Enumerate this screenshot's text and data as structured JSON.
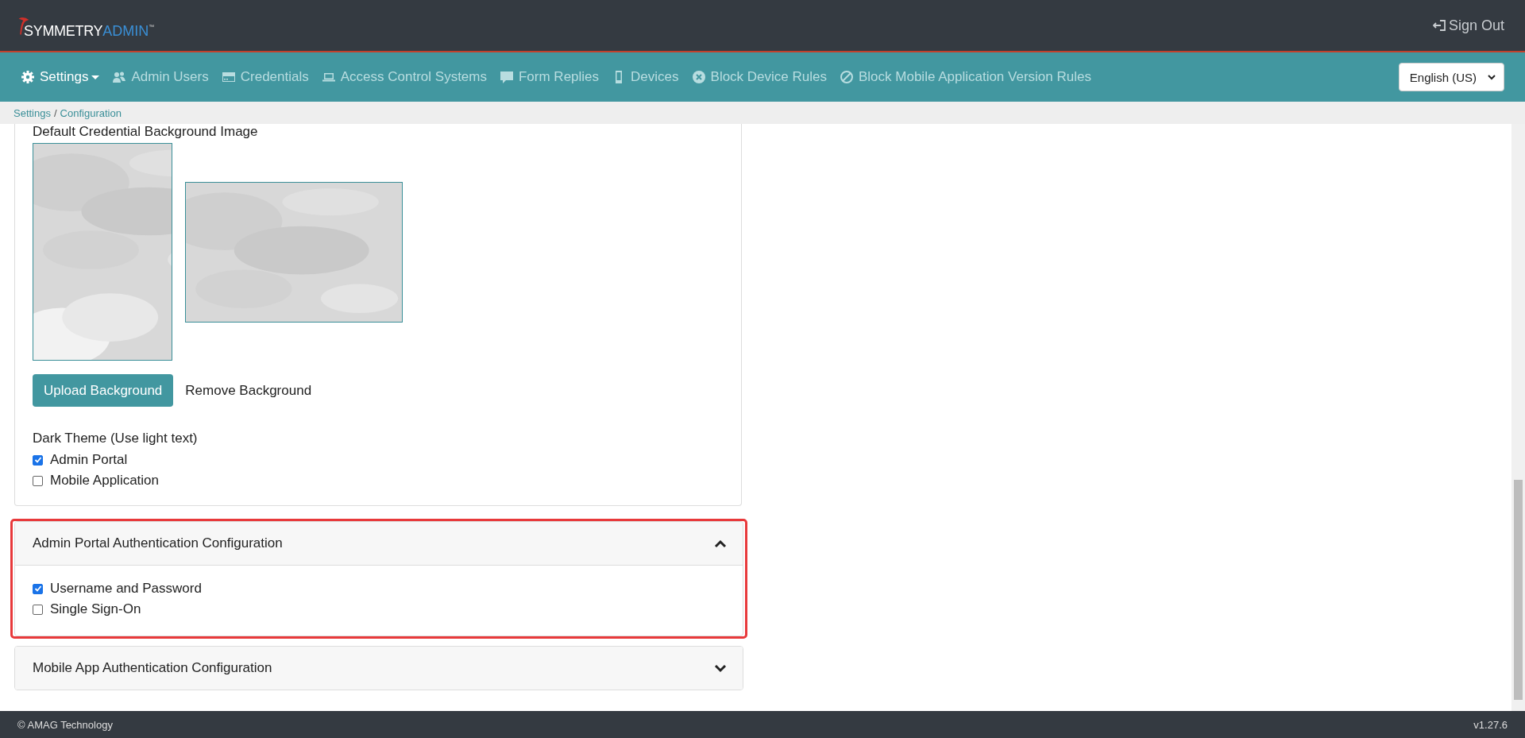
{
  "logo": {
    "text": "SYMMETRY",
    "accent": "ADMIN",
    "mark": "™"
  },
  "sign_out": "Sign Out",
  "nav": [
    {
      "label": "Settings",
      "selected": true,
      "dropdown": true
    },
    {
      "label": "Admin Users",
      "selected": false,
      "dropdown": false
    },
    {
      "label": "Credentials",
      "selected": false,
      "dropdown": false
    },
    {
      "label": "Access Control Systems",
      "selected": false,
      "dropdown": false
    },
    {
      "label": "Form Replies",
      "selected": false,
      "dropdown": false
    },
    {
      "label": "Devices",
      "selected": false,
      "dropdown": false
    },
    {
      "label": "Block Device Rules",
      "selected": false,
      "dropdown": false
    },
    {
      "label": "Block Mobile Application Version Rules",
      "selected": false,
      "dropdown": false
    }
  ],
  "language": {
    "value": "English (US)"
  },
  "breadcrumb": {
    "items": [
      "Settings",
      "Configuration"
    ],
    "separator": "/"
  },
  "background_card": {
    "label": "Default Credential Background Image",
    "upload_button": "Upload Background",
    "remove_link": "Remove Background",
    "dark_theme_label": "Dark Theme (Use light text)",
    "options": [
      {
        "label": "Admin Portal",
        "checked": true
      },
      {
        "label": "Mobile Application",
        "checked": false
      }
    ]
  },
  "panels": [
    {
      "title": "Admin Portal Authentication Configuration",
      "expanded": true,
      "highlighted": true,
      "options": [
        {
          "label": "Username and Password",
          "checked": true
        },
        {
          "label": "Single Sign-On",
          "checked": false
        }
      ]
    },
    {
      "title": "Mobile App Authentication Configuration",
      "expanded": false,
      "highlighted": false
    }
  ],
  "footer": {
    "copyright": "© AMAG Technology",
    "version": "v1.27.6"
  }
}
